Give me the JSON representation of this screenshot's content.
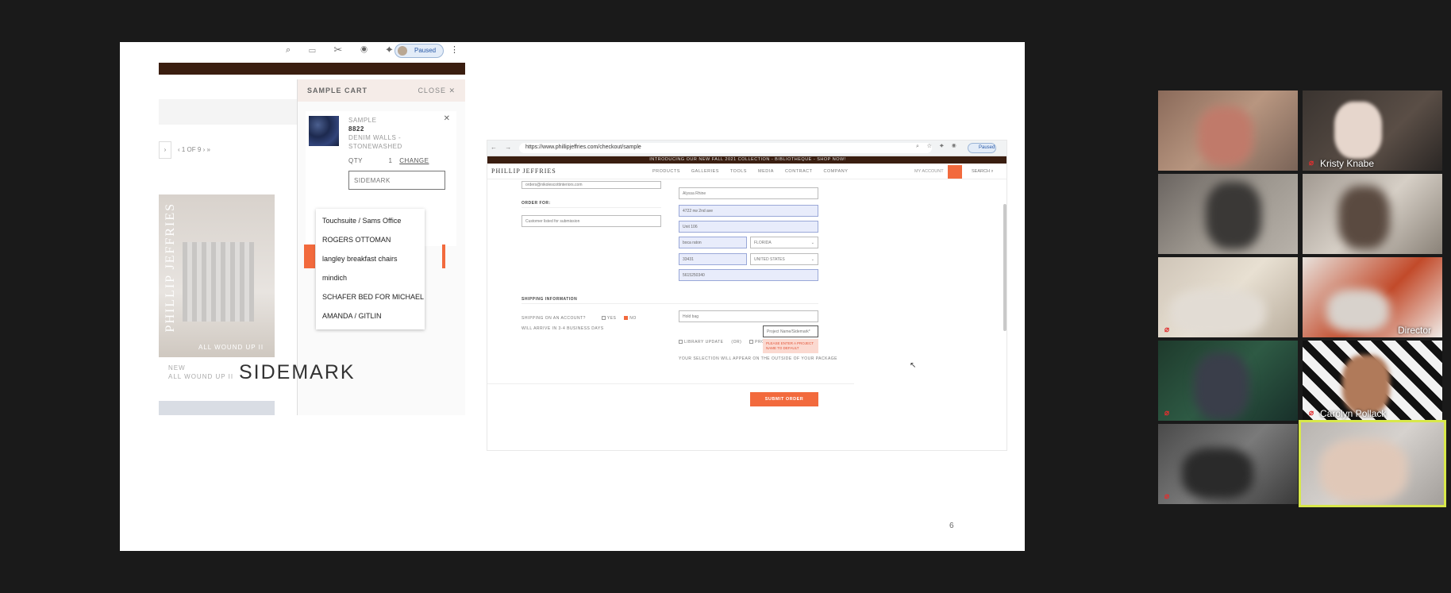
{
  "slide": {
    "caption": "SIDEMARK",
    "page_number": "6"
  },
  "left_shot": {
    "browser": {
      "paused_label": "Paused"
    },
    "pagination": "‹  1 OF 9  ›  »",
    "pagination_prev": "‹ «",
    "product_brand_watermark": "PHILLIP JEFFRIES",
    "product_overlay": "ALL WOUND UP II",
    "product_caption_line1": "NEW",
    "product_caption_line2": "ALL WOUND UP II",
    "cart": {
      "title": "SAMPLE CART",
      "close_label": "CLOSE ✕",
      "item_type": "SAMPLE",
      "item_sku": "8822",
      "item_name_line1": "DENIM WALLS -",
      "item_name_line2": "STONEWASHED",
      "qty_label": "QTY",
      "qty_value": "1",
      "change_label": "CHANGE",
      "sidemark_placeholder": "SIDEMARK",
      "dropdown_options": [
        "Touchsuite / Sams Office",
        "ROGERS OTTOMAN",
        "langley breakfast chairs",
        "mindich",
        "SCHAFER BED FOR MICHAEL",
        "AMANDA / GITLIN"
      ]
    }
  },
  "right_shot": {
    "url": "https://www.phillipjeffries.com/checkout/sample",
    "paused_label": "Paused",
    "promo": "INTRODUCING OUR NEW FALL 2021 COLLECTION - BIBLIOTHEQUE - SHOP NOW!",
    "logo": "PHILLIP JEFFRIES",
    "menu": [
      "PRODUCTS",
      "GALLERIES",
      "TOOLS",
      "MEDIA",
      "CONTRACT",
      "COMPANY"
    ],
    "account": "MY ACCOUNT",
    "search": "SEARCH",
    "email_value": "orders@nikolescottinteriors.com",
    "order_for_label": "ORDER FOR:",
    "order_for_placeholder": "Customer listed for submission",
    "address": {
      "name": "Alyssa Rhine",
      "street": "4722 nw 2nd ave",
      "unit": "Unit 106",
      "city": "boca raton",
      "state": "FLORIDA",
      "zip": "33431",
      "country": "UNITED STATES",
      "phone": "5615250340"
    },
    "shipping_info_label": "SHIPPING INFORMATION",
    "shipping_account_label": "SHIPPING ON AN ACCOUNT?",
    "yes_label": "YES",
    "no_label": "NO",
    "arrival_note": "WILL ARRIVE IN 3-4 BUSINESS DAYS",
    "ship_via_value": "Hold bag",
    "project_placeholder": "Project Name/Sidemark*",
    "library_label": "LIBRARY UPDATE",
    "or_label": "(OR)",
    "project_name_label": "PROJECT NAME",
    "error_text": "PLEASE ENTER A PROJECT NAME TO DEFAULT",
    "package_note": "YOUR SELECTION WILL APPEAR ON THE OUTSIDE OF YOUR PACKAGE",
    "submit_label": "SUBMIT ORDER"
  },
  "participants": [
    {
      "name": "",
      "muted": false
    },
    {
      "name": "Kristy Knabe",
      "muted": true
    },
    {
      "name": "",
      "muted": false
    },
    {
      "name": "",
      "muted": false
    },
    {
      "name": "",
      "muted": true
    },
    {
      "name": "Director",
      "muted": false
    },
    {
      "name": "",
      "muted": true
    },
    {
      "name": "Carolyn Pollack",
      "muted": true
    },
    {
      "name": "",
      "muted": true
    },
    {
      "name": "",
      "muted": false
    }
  ],
  "colors": {
    "accent_orange": "#f26a3d",
    "brand_brown": "#3a1e10",
    "active_speaker": "#d8e84a",
    "muted_red": "#e03030"
  }
}
